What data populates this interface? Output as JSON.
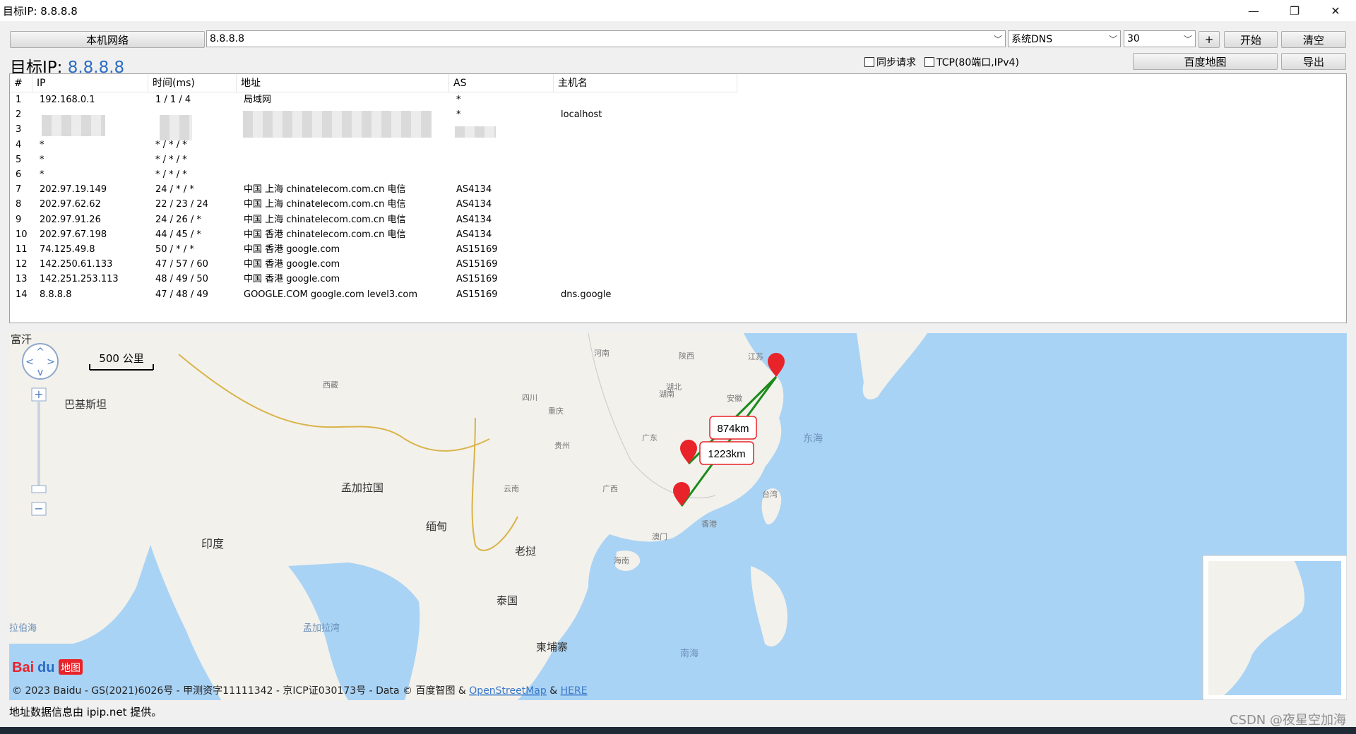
{
  "window": {
    "title": "目标IP: 8.8.8.8",
    "minimize": "—",
    "restore": "❐",
    "close": "✕"
  },
  "toolbar": {
    "local_network": "本机网络",
    "ip_input": "8.8.8.8",
    "dns_select": "系统DNS",
    "count_select": "30",
    "plus": "+",
    "start": "开始",
    "clear": "清空",
    "baidu_map": "百度地图",
    "export": "导出",
    "sync_label": "同步请求",
    "tcp_label": "TCP(80端口,IPv4)"
  },
  "target": {
    "label": "目标IP: ",
    "ip": "8.8.8.8"
  },
  "table": {
    "headers": [
      "#",
      "IP",
      "时间(ms)",
      "地址",
      "AS",
      "主机名"
    ],
    "rows": [
      [
        "1",
        "192.168.0.1",
        "1 / 1 / 4",
        "局域网",
        "*",
        ""
      ],
      [
        "2",
        "",
        "",
        "",
        "*",
        "localhost"
      ],
      [
        "3",
        "",
        "",
        "",
        "",
        ""
      ],
      [
        "4",
        "*",
        "* / * / *",
        "",
        "",
        ""
      ],
      [
        "5",
        "*",
        "* / * / *",
        "",
        "",
        ""
      ],
      [
        "6",
        "*",
        "* / * / *",
        "",
        "",
        ""
      ],
      [
        "7",
        "202.97.19.149",
        "24 / * / *",
        "中国 上海 chinatelecom.com.cn 电信",
        "AS4134",
        ""
      ],
      [
        "8",
        "202.97.62.62",
        "22 / 23 / 24",
        "中国 上海 chinatelecom.com.cn 电信",
        "AS4134",
        ""
      ],
      [
        "9",
        "202.97.91.26",
        "24 / 26 / *",
        "中国 上海 chinatelecom.com.cn 电信",
        "AS4134",
        ""
      ],
      [
        "10",
        "202.97.67.198",
        "44 / 45 / *",
        "中国 香港 chinatelecom.com.cn 电信",
        "AS4134",
        ""
      ],
      [
        "11",
        "74.125.49.8",
        "50 / * / *",
        "中国 香港 google.com",
        "AS15169",
        ""
      ],
      [
        "12",
        "142.250.61.133",
        "47 / 57 / 60",
        "中国 香港 google.com",
        "AS15169",
        ""
      ],
      [
        "13",
        "142.251.253.113",
        "48 / 49 / 50",
        "中国 香港 google.com",
        "AS15169",
        ""
      ],
      [
        "14",
        "8.8.8.8",
        "47 / 48 / 49",
        "GOOGLE.COM google.com level3.com",
        "AS15169",
        "dns.google"
      ]
    ]
  },
  "map": {
    "scale": "500 公里",
    "labels": [
      "富汗",
      "巴基斯坦",
      "印度",
      "孟加拉国",
      "缅甸",
      "老挝",
      "泰国",
      "柬埔寨",
      "西藏",
      "四川",
      "重庆",
      "贵州",
      "云南",
      "广西",
      "广东",
      "湖南",
      "湖北",
      "河南",
      "陕西",
      "安徽",
      "江苏",
      "东海",
      "台湾",
      "海南",
      "香港",
      "澳门",
      "南海",
      "拉伯海",
      "孟加拉湾",
      "埔寨"
    ],
    "distance_1": "874km",
    "distance_2": "1223km",
    "baidu_logo_bai": "Bai",
    "baidu_logo_du": "du",
    "baidu_logo_map": "地图",
    "copyright_prefix": "© 2023 Baidu - GS(2021)6026号 - 甲测资字11111342 - 京ICP证030173号 - Data © 百度智图 & ",
    "osm": "OpenStreetMap",
    "amp": " & ",
    "here": "HERE",
    "land_color": "#f3f1ec",
    "sea_color": "#a9d3f5",
    "route_color": "#1a8a1a",
    "marker_color": "#e8232a"
  },
  "status": "地址数据信息由 ipip.net 提供。",
  "watermark": "CSDN @夜星空加海"
}
